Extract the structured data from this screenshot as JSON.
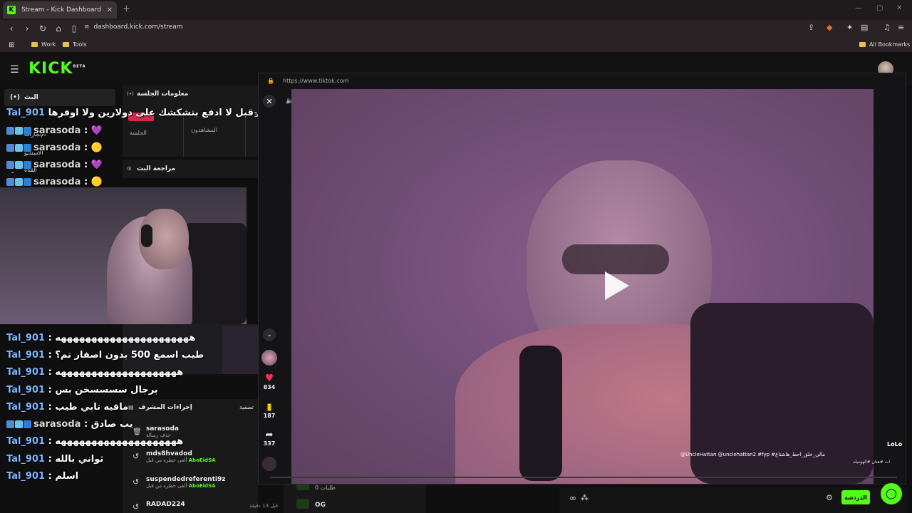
{
  "browser": {
    "tab_title": "Stream - Kick Dashboard",
    "tab_favicon": "K",
    "url": "dashboard.kick.com/stream",
    "bookmarks": [
      "Work",
      "Tools"
    ],
    "all_bookmarks": "All Bookmarks"
  },
  "kick": {
    "logo": "KICK",
    "logo_badge": "BETA",
    "accent": "#53fc18"
  },
  "panes": {
    "stream_label": "البث",
    "session_info": "معلومات الجلسة",
    "session_label": "الجلسة",
    "viewers_label": "المشاهدون",
    "stream_review": "مراجعة البث",
    "mod_actions": "إجراءات المشرف",
    "filter_label": "تصفية",
    "shortcuts": "الإنجازات",
    "studio": "الاستديو",
    "channel": "القناة",
    "requests": "طلبات 0",
    "og": "OG",
    "ago": "قبل 13 دقيقة"
  },
  "chat_overlay": [
    {
      "user": "Tal_901",
      "msg": "طيب اسمع قبل لا ادفع بتشكشك على دولارين ولا اوفرها :"
    },
    {
      "user": "sarasoda",
      "msg": ": 💜"
    },
    {
      "user": "sarasoda",
      "msg": ": 🟡"
    },
    {
      "user": "sarasoda",
      "msg": ": 💜"
    },
    {
      "user": "sarasoda",
      "msg": ": 🟡"
    },
    {
      "user": "Tal_901",
      "msg": ": ههههههههههههههههههههههه"
    },
    {
      "user": "Tal_901",
      "msg": ": طيب اسمع 500 بدون اصفار تم؟"
    },
    {
      "user": "Tal_901",
      "msg": ": ههههههههههههههههههههه"
    },
    {
      "user": "Tal_901",
      "msg": ": برجال سسسسخن بس"
    },
    {
      "user": "Tal_901",
      "msg": ": مافيه تابي طيب"
    },
    {
      "user": "sarasoda",
      "msg": ": يب صادق"
    },
    {
      "user": "Tal_901",
      "msg": ": ههههههههههههههههههههه"
    },
    {
      "user": "Tal_901",
      "msg": ": ثواني بالله"
    },
    {
      "user": "Tal_901",
      "msg": ": اسلم"
    }
  ],
  "mod_log": [
    {
      "name": "sarasoda",
      "sub": "حذف رسالة",
      "by": ""
    },
    {
      "name": "mds8hvadod",
      "sub": "ألغى حظره من قبل",
      "by": "AboEidSA"
    },
    {
      "name": "suspendedreferenti9z",
      "sub": "ألغى حظره من قبل",
      "by": "AboEidSA"
    },
    {
      "name": "RADAD224",
      "sub": "",
      "by": ""
    }
  ],
  "tiktok": {
    "url": "https://www.tiktok.com",
    "likes": "834",
    "saves": "187",
    "shares": "337",
    "author": "LoLo",
    "caption": "@UncleHattan @unclehattan2 #fyp #مالي_خلق_احط_هاشتاغ",
    "caption2": "ات #هتان #الهوميله"
  },
  "chat_input": {
    "send": "الدردشة",
    "icon_symbol": "∞"
  }
}
